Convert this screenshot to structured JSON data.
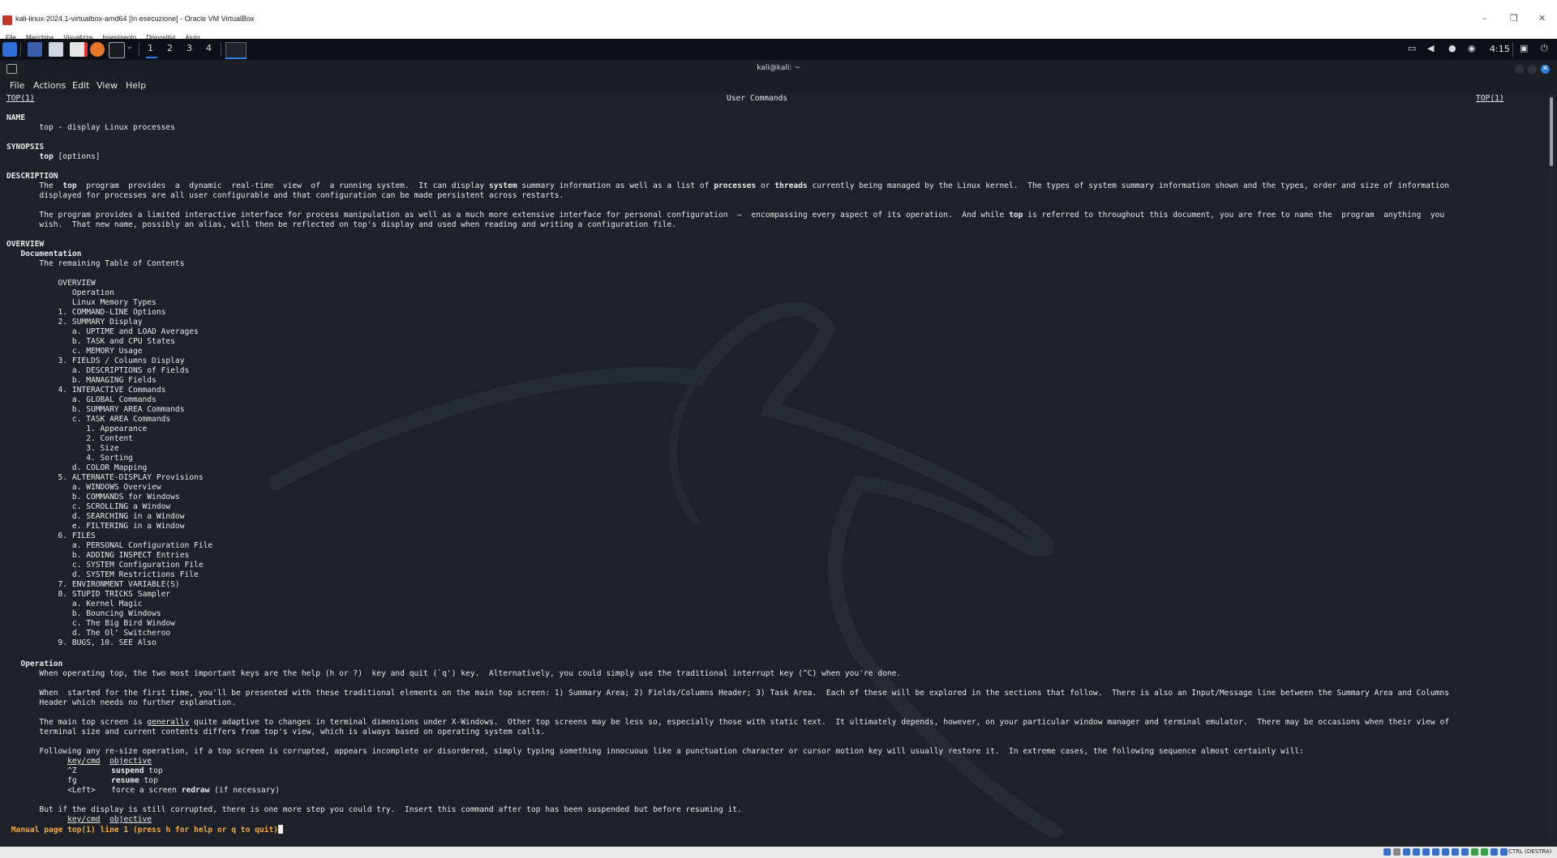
{
  "host": {
    "title": "kali-linux-2024.1-virtualbox-amd64 [In esecuzione] - Oracle VM VirtualBox",
    "menu": [
      "File",
      "Macchina",
      "Visualizza",
      "Inserimento",
      "Dispositivi",
      "Aiuto"
    ],
    "status_key": "CTRL (DESTRA)"
  },
  "panel": {
    "workspaces": [
      "1",
      "2",
      "3",
      "4"
    ],
    "clock": "4:15"
  },
  "terminal": {
    "title": "kali@kali: ~",
    "menu": [
      "File",
      "Actions",
      "Edit",
      "View",
      "Help"
    ]
  },
  "man": {
    "header_left": "TOP(1)",
    "header_center": "User Commands",
    "header_right": "TOP(1)",
    "name_heading": "NAME",
    "name_line": "       top - display Linux processes",
    "synopsis_heading": "SYNOPSIS",
    "synopsis_cmd": "top",
    "synopsis_rest": " [options]",
    "description_heading": "DESCRIPTION",
    "desc1_a": "       The  ",
    "desc1_top": "top",
    "desc1_b": "  program  provides  a  dynamic  real-time  view  of  a running system.  It can display ",
    "desc1_system": "system",
    "desc1_c": " summary information as well as a list of ",
    "desc1_processes": "processes",
    "desc1_d": " or ",
    "desc1_threads": "threads",
    "desc1_e": " currently being managed by the Linux kernel.  The types of system summary information shown and the types, order and size of information",
    "desc1_line2": "       displayed for processes are all user configurable and that configuration can be made persistent across restarts.",
    "desc2_a": "       The program provides a limited interactive interface for process manipulation as well as a much more extensive interface for personal configuration  —  encompassing every aspect of its operation.  And while ",
    "desc2_top": "top",
    "desc2_b": " is referred to throughout this document, you are free to name the  program  anything  you",
    "desc2_line2": "       wish.  That new name, possibly an alias, will then be reflected on top's display and used when reading and writing a configuration file.",
    "overview_heading": "OVERVIEW",
    "documentation_heading": "   Documentation",
    "toc_intro": "       The remaining Table of Contents",
    "toc": [
      "           OVERVIEW",
      "              Operation",
      "              Linux Memory Types",
      "           1. COMMAND-LINE Options",
      "           2. SUMMARY Display",
      "              a. UPTIME and LOAD Averages",
      "              b. TASK and CPU States",
      "              c. MEMORY Usage",
      "           3. FIELDS / Columns Display",
      "              a. DESCRIPTIONS of Fields",
      "              b. MANAGING Fields",
      "           4. INTERACTIVE Commands",
      "              a. GLOBAL Commands",
      "              b. SUMMARY AREA Commands",
      "              c. TASK AREA Commands",
      "                 1. Appearance",
      "                 2. Content",
      "                 3. Size",
      "                 4. Sorting",
      "              d. COLOR Mapping",
      "           5. ALTERNATE-DISPLAY Provisions",
      "              a. WINDOWS Overview",
      "              b. COMMANDS for Windows",
      "              c. SCROLLING a Window",
      "              d. SEARCHING in a Window",
      "              e. FILTERING in a Window",
      "           6. FILES",
      "              a. PERSONAL Configuration File",
      "              b. ADDING INSPECT Entries",
      "              c. SYSTEM Configuration File",
      "              d. SYSTEM Restrictions File",
      "           7. ENVIRONMENT VARIABLE(S)",
      "           8. STUPID TRICKS Sampler",
      "              a. Kernel Magic",
      "              b. Bouncing Windows",
      "              c. The Big Bird Window",
      "              d. The Ol' Switcheroo",
      "           9. BUGS, 10. SEE Also"
    ],
    "operation_heading": "   Operation",
    "op1": "       When operating top, the two most important keys are the help (h or ?)  key and quit (`q') key.  Alternatively, you could simply use the traditional interrupt key (^C) when you're done.",
    "op2_line1": "       When  started for the first time, you'll be presented with these traditional elements on the main top screen: 1) Summary Area; 2) Fields/Columns Header; 3) Task Area.  Each of these will be explored in the sections that follow.  There is also an Input/Message line between the Summary Area and Columns",
    "op2_line2": "       Header which needs no further explanation.",
    "op3_a": "       The main top screen is ",
    "op3_generally": "generally",
    "op3_b": " quite adaptive to changes in terminal dimensions under X-Windows.  Other top screens may be less so, especially those with static text.  It ultimately depends, however, on your particular window manager and terminal emulator.  There may be occasions when their view of",
    "op3_line2": "       terminal size and current contents differs from top's view, which is always based on operating system calls.",
    "op4": "       Following any re-size operation, if a top screen is corrupted, appears incomplete or disordered, simply typing something innocuous like a punctuation character or cursor motion key will usually restore it.  In extreme cases, the following sequence almost certainly will:",
    "kt_head_key": "key/cmd",
    "kt_head_obj": "objective",
    "kt_rows": [
      {
        "key": "^Z",
        "obj": "suspend",
        "rest": " top"
      },
      {
        "key": "fg",
        "obj": "resume",
        "rest": " top"
      },
      {
        "key": "<Left>",
        "obj_pre": "force a screen ",
        "obj": "redraw",
        "rest": " (if necessary)"
      }
    ],
    "op5": "       But if the display is still corrupted, there is one more step you could try.  Insert this command after top has been suspended but before resuming it.",
    "kt2_head_key": "key/cmd",
    "kt2_head_obj": "objective",
    "status_line": " Manual page top(1) line 1 (press h for help or q to quit)"
  }
}
